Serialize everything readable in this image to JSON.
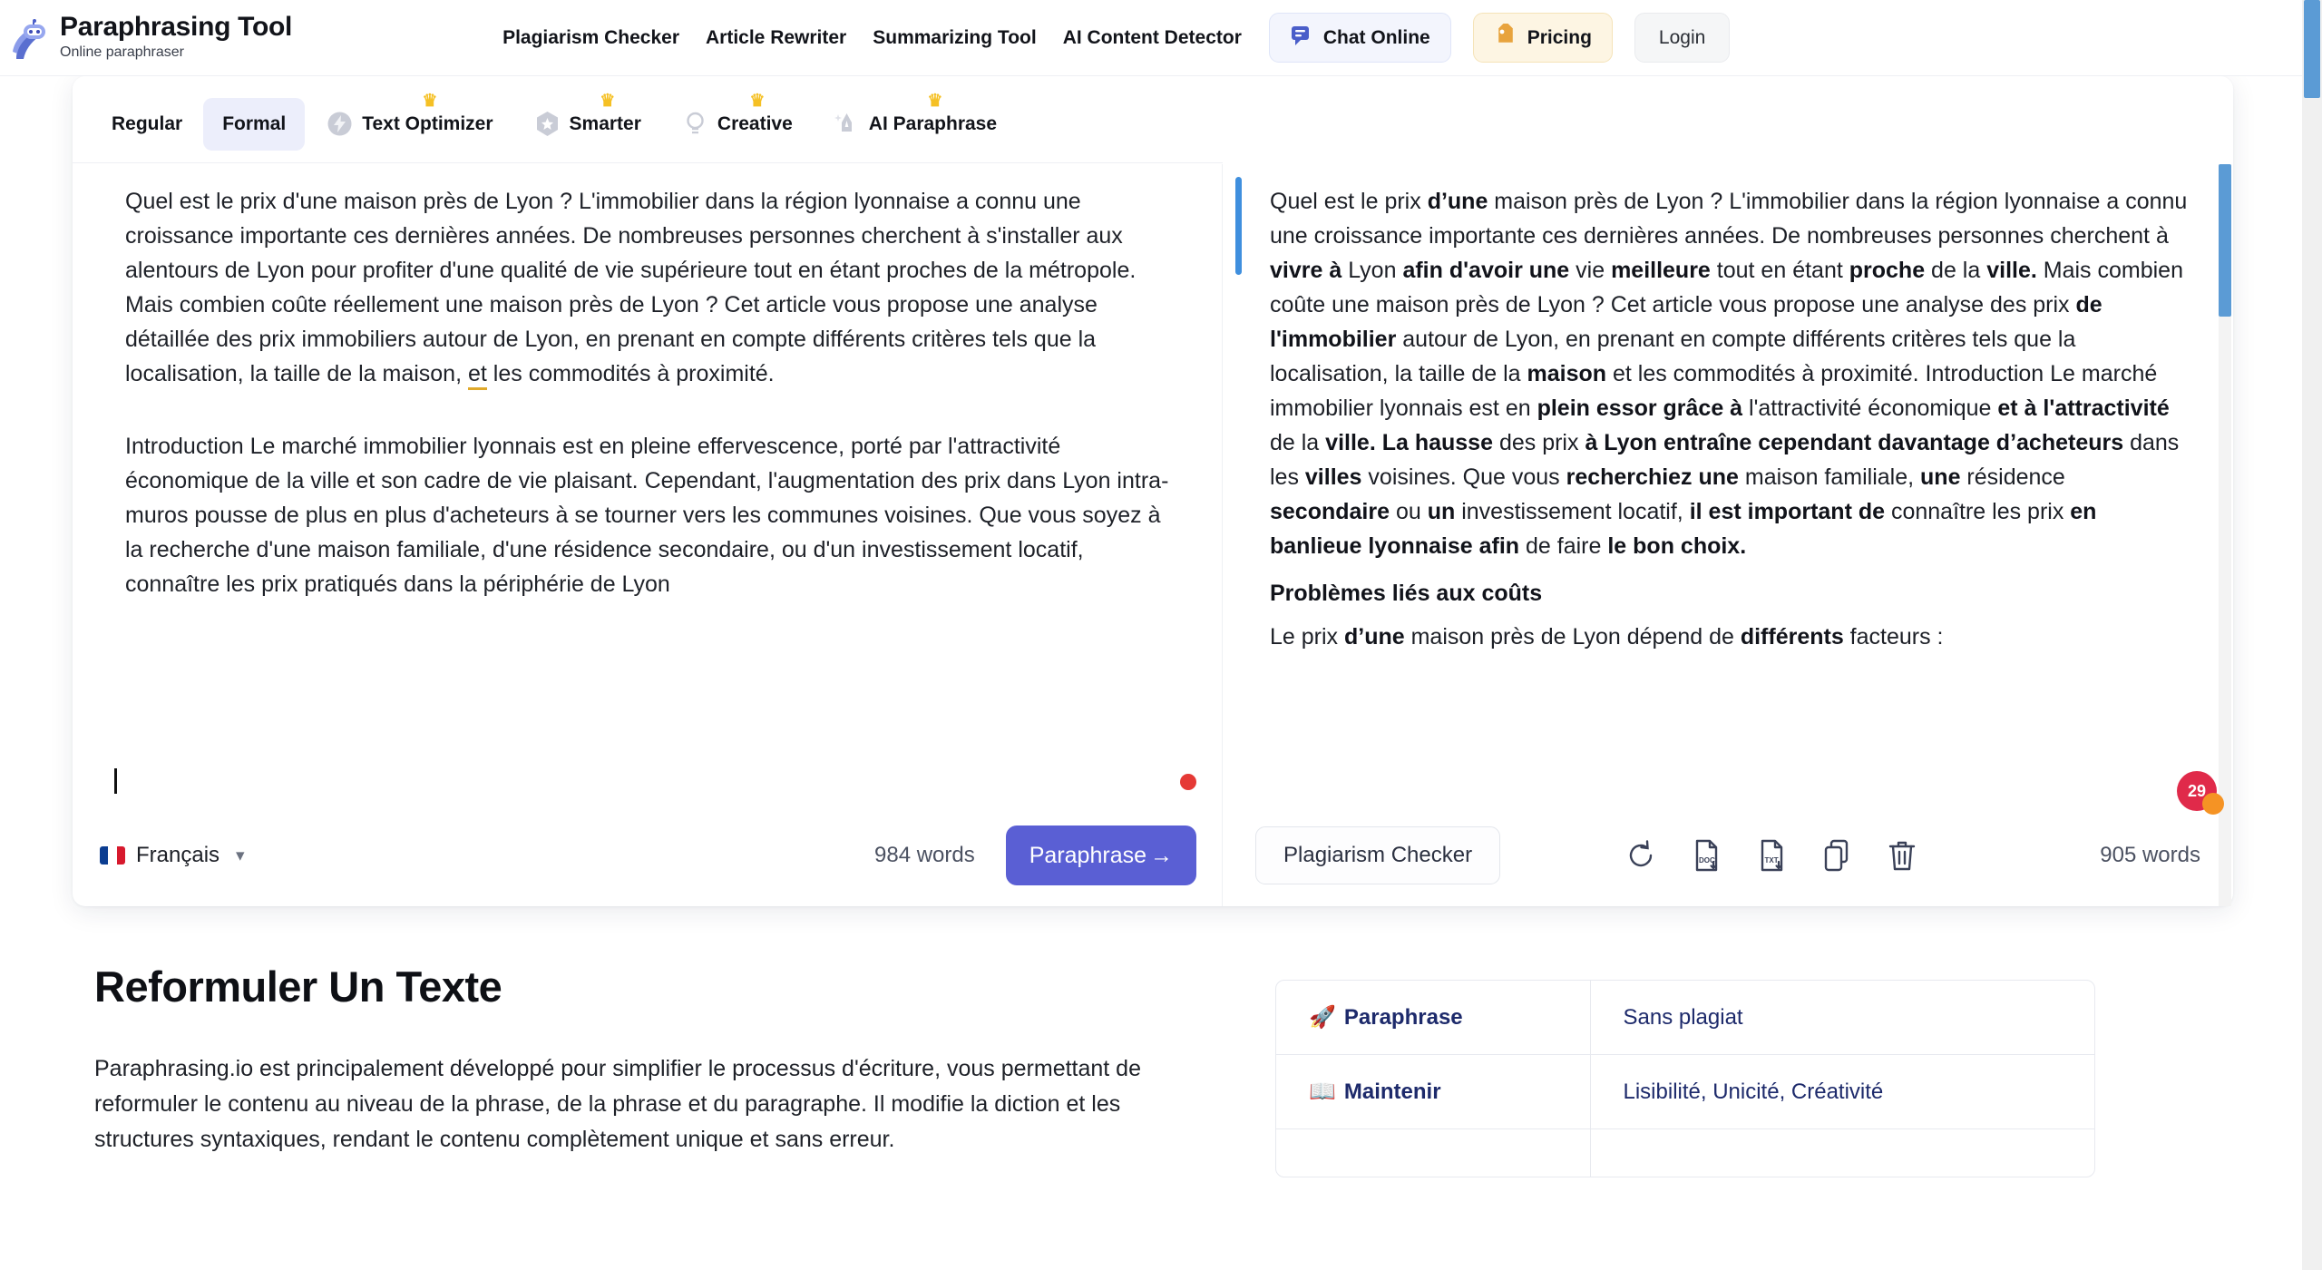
{
  "brand": {
    "title": "Paraphrasing Tool",
    "subtitle": "Online paraphraser",
    "logo_icon": "robot-logo-icon"
  },
  "nav": {
    "links": [
      {
        "label": "Plagiarism Checker"
      },
      {
        "label": "Article Rewriter"
      },
      {
        "label": "Summarizing Tool"
      },
      {
        "label": "AI Content Detector"
      }
    ],
    "actions": {
      "chat": {
        "label": "Chat Online",
        "icon": "chat-bubble-icon"
      },
      "pricing": {
        "label": "Pricing",
        "icon": "price-tag-icon"
      },
      "login": {
        "label": "Login"
      }
    }
  },
  "tool": {
    "tabs": [
      {
        "label": "Regular",
        "active": false,
        "premium": false,
        "icon": null
      },
      {
        "label": "Formal",
        "active": true,
        "premium": false,
        "icon": null
      },
      {
        "label": "Text Optimizer",
        "active": false,
        "premium": true,
        "icon": "lightning-badge-icon"
      },
      {
        "label": "Smarter",
        "active": false,
        "premium": true,
        "icon": "star-badge-icon"
      },
      {
        "label": "Creative",
        "active": false,
        "premium": true,
        "icon": "lightbulb-icon"
      },
      {
        "label": "AI Paraphrase",
        "active": false,
        "premium": true,
        "icon": "fountain-pen-icon"
      }
    ],
    "crown_icon": "crown-icon",
    "input": {
      "paragraph1_pre": "Quel est le prix d'une maison près de Lyon ?\nL'immobilier dans la région lyonnaise a connu une croissance importante ces dernières années. De nombreuses personnes cherchent à s'installer aux alentours de Lyon pour profiter d'une qualité de vie supérieure tout en étant proches de la métropole. Mais combien coûte réellement une maison près de Lyon ? Cet article vous propose une analyse détaillée des prix immobiliers autour de Lyon, en prenant en compte différents critères tels que la localisation, la taille de la maison, ",
      "suggestion_word": "et",
      "paragraph1_post": " les commodités à proximité.",
      "paragraph2": "Introduction\nLe marché immobilier lyonnais est en pleine effervescence, porté par l'attractivité économique de la ville et son cadre de vie plaisant. Cependant, l'augmentation des prix dans Lyon intra-muros pousse de plus en plus d'acheteurs à se tourner vers les communes voisines. Que vous soyez à la recherche d'une maison familiale, d'une résidence secondaire, ou d'un investissement locatif, connaître les prix pratiqués dans la périphérie de Lyon"
    },
    "input_footer": {
      "language": "Français",
      "language_flag": "french-flag-icon",
      "chevron_icon": "chevron-down-icon",
      "word_count": "984 words",
      "paraphrase_button": "Paraphrase",
      "arrow_icon": "arrow-right-icon"
    },
    "output": {
      "segments": [
        {
          "t": "Quel est le prix ",
          "b": false
        },
        {
          "t": "d’une",
          "b": true
        },
        {
          "t": " maison près de Lyon ? L'immobilier dans la région lyonnaise a connu une croissance importante ces dernières années. De nombreuses personnes cherchent à ",
          "b": false
        },
        {
          "t": "vivre à",
          "b": true
        },
        {
          "t": " Lyon ",
          "b": false
        },
        {
          "t": "afin d'avoir une",
          "b": true
        },
        {
          "t": " vie ",
          "b": false
        },
        {
          "t": "meilleure",
          "b": true
        },
        {
          "t": " tout en étant ",
          "b": false
        },
        {
          "t": "proche",
          "b": true
        },
        {
          "t": " de la ",
          "b": false
        },
        {
          "t": "ville.",
          "b": true
        },
        {
          "t": " Mais combien coûte une maison près de Lyon ? Cet article vous propose une analyse des prix ",
          "b": false
        },
        {
          "t": "de l'immobilier",
          "b": true
        },
        {
          "t": " autour de Lyon, en prenant en compte différents critères tels que la localisation, la taille de la ",
          "b": false
        },
        {
          "t": "maison",
          "b": true
        },
        {
          "t": " et les commodités à proximité. Introduction Le marché immobilier lyonnais est en ",
          "b": false
        },
        {
          "t": "plein essor grâce à",
          "b": true
        },
        {
          "t": " l'attractivité économique ",
          "b": false
        },
        {
          "t": "et à l'attractivité",
          "b": true
        },
        {
          "t": " de la ",
          "b": false
        },
        {
          "t": "ville. La hausse",
          "b": true
        },
        {
          "t": " des prix ",
          "b": false
        },
        {
          "t": "à Lyon entraîne cependant davantage d’acheteurs",
          "b": true
        },
        {
          "t": " dans les ",
          "b": false
        },
        {
          "t": "villes",
          "b": true
        },
        {
          "t": " voisines. Que vous ",
          "b": false
        },
        {
          "t": "recherchiez une",
          "b": true
        },
        {
          "t": " maison familiale, ",
          "b": false
        },
        {
          "t": "une",
          "b": true
        },
        {
          "t": " résidence ",
          "b": false
        },
        {
          "t": "secondaire",
          "b": true
        },
        {
          "t": " ou ",
          "b": false
        },
        {
          "t": "un",
          "b": true
        },
        {
          "t": " investissement locatif, ",
          "b": false
        },
        {
          "t": "il est important de",
          "b": true
        },
        {
          "t": " connaître les prix ",
          "b": false
        },
        {
          "t": "en banlieue lyonnaise afin",
          "b": true
        },
        {
          "t": " de faire ",
          "b": false
        },
        {
          "t": "le bon choix.",
          "b": true
        }
      ],
      "heading": "Problèmes liés aux coûts",
      "tail_segments": [
        {
          "t": "Le prix ",
          "b": false
        },
        {
          "t": "d’une",
          "b": true
        },
        {
          "t": " maison près de Lyon dépend de ",
          "b": false
        },
        {
          "t": "différents",
          "b": true
        },
        {
          "t": " facteurs :",
          "b": false
        }
      ]
    },
    "output_footer": {
      "plagiarism_button": "Plagiarism Checker",
      "icons": [
        {
          "name": "refresh-icon"
        },
        {
          "name": "download-doc-icon",
          "label": "DOC"
        },
        {
          "name": "download-txt-icon",
          "label": "TXT"
        },
        {
          "name": "copy-icon"
        },
        {
          "name": "trash-icon"
        }
      ],
      "word_count": "905 words"
    }
  },
  "chat_badge": {
    "count": "29"
  },
  "bottom": {
    "title": "Reformuler Un Texte",
    "body": "Paraphrasing.io est principalement développé pour simplifier le processus d'écriture, vous permettant de reformuler le contenu au niveau de la phrase, de la phrase et du paragraphe. Il modifie la diction et les structures syntaxiques, rendant le contenu complètement unique et sans erreur.",
    "table": {
      "rows": [
        {
          "icon": "rocket-icon",
          "label": "Paraphrase",
          "value": "Sans plagiat"
        },
        {
          "icon": "open-book-icon",
          "label": "Maintenir",
          "value": "Lisibilité, Unicité, Créativité"
        },
        {
          "icon": "",
          "label": "",
          "value": ""
        }
      ]
    }
  },
  "colors": {
    "accent_blue": "#5a5fd4",
    "scroll_blue": "#5b9bd5",
    "crown_yellow": "#f5c024",
    "badge_red": "#e02a4a",
    "badge_orange": "#f59324",
    "suggestion_orange": "#e0a92b",
    "table_text": "#1d2a6b"
  }
}
